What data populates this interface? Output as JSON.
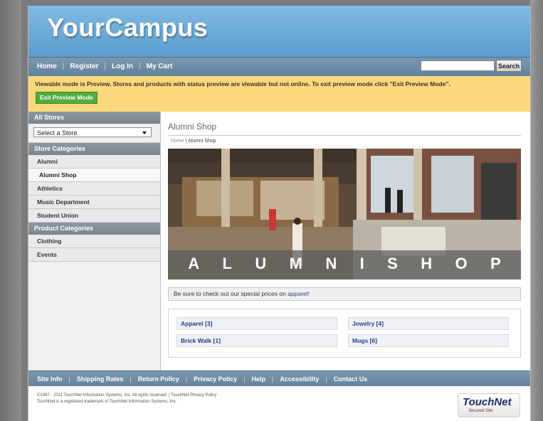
{
  "header": {
    "logo": "YourCampus"
  },
  "topnav": {
    "items": [
      "Home",
      "Register",
      "Log In",
      "My Cart"
    ],
    "search_button": "Search",
    "search_value": ""
  },
  "preview": {
    "message": "Viewable mode is Preview. Stores and products with status preview are viewable but not online. To exit preview mode click \"Exit Preview Mode\".",
    "button": "Exit Preview Mode"
  },
  "sidebar": {
    "all_stores": "All Stores",
    "select_value": "Select a Store",
    "store_categories_header": "Store Categories",
    "store_categories": [
      "Alumni",
      "Alumni Shop",
      "Athletics",
      "Music Department",
      "Student Union"
    ],
    "product_categories_header": "Product Categories",
    "product_categories": [
      "Clothing",
      "Events"
    ]
  },
  "content": {
    "title": "Alumni Shop",
    "breadcrumb": {
      "home": "Home",
      "sep": " | ",
      "current": "Alumni Shop"
    },
    "banner_letters": [
      "A",
      "L",
      "U",
      "M",
      "N",
      "I",
      "S",
      "H",
      "O",
      "P"
    ],
    "special_text": "Be sure to check out our special prices on ",
    "special_link": "apparel!",
    "categories": [
      "Apparel [3]",
      "Jewelry [4]",
      "Brick Walk [1]",
      "Mugs [6]"
    ]
  },
  "footnav": {
    "items": [
      "Site Info",
      "Shipping Rates",
      "Return Policy",
      "Privacy Policy",
      "Help",
      "Accessibility",
      "Contact Us"
    ]
  },
  "footer": {
    "line1": "©1997 - 2011 TouchNet Information Systems, Inc. All rights reserved. | TouchNet Privacy Policy",
    "line2": "TouchNet is a registered trademark of TouchNet Information Systems, Inc.",
    "logo_text": "TouchNet",
    "logo_sub": "Secured Site"
  },
  "colors": {
    "header": "#6aa8d6",
    "nav": "#6e8ba5",
    "preview": "#fbd879",
    "preview_button": "#4fae3e",
    "link": "#23408a"
  }
}
